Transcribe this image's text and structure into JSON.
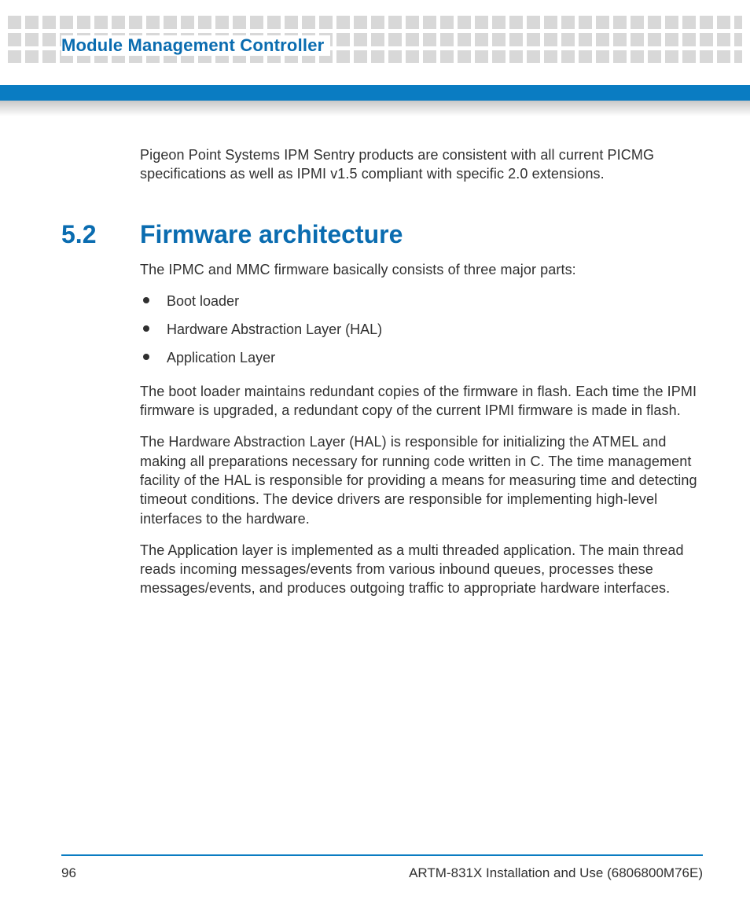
{
  "header": {
    "chapter_title": "Module Management Controller"
  },
  "intro_para": "Pigeon Point Systems IPM Sentry products are consistent with all current PICMG specifications as well as IPMI v1.5 compliant with specific 2.0 extensions.",
  "section": {
    "number": "5.2",
    "title": "Firmware architecture",
    "lead": "The IPMC and MMC firmware basically consists of three major parts:",
    "bullets": [
      "Boot loader",
      "Hardware Abstraction Layer (HAL)",
      "Application Layer"
    ],
    "paras": [
      "The boot loader maintains redundant copies of the firmware in flash. Each time the IPMI firmware is upgraded, a redundant copy of the current IPMI firmware is made in flash.",
      "The Hardware Abstraction Layer (HAL) is responsible for initializing the ATMEL and making all preparations necessary for running code written in C. The time management facility of the HAL is responsible for providing a means for measuring time and detecting timeout conditions. The device drivers are responsible for implementing high-level interfaces to the hardware.",
      "The Application layer is implemented as a multi threaded application. The main thread reads incoming messages/events from various inbound queues, processes these messages/events, and produces outgoing traffic to appropriate hardware interfaces."
    ]
  },
  "footer": {
    "page_number": "96",
    "doc_ref": "ARTM-831X Installation and Use (6806800M76E)"
  }
}
